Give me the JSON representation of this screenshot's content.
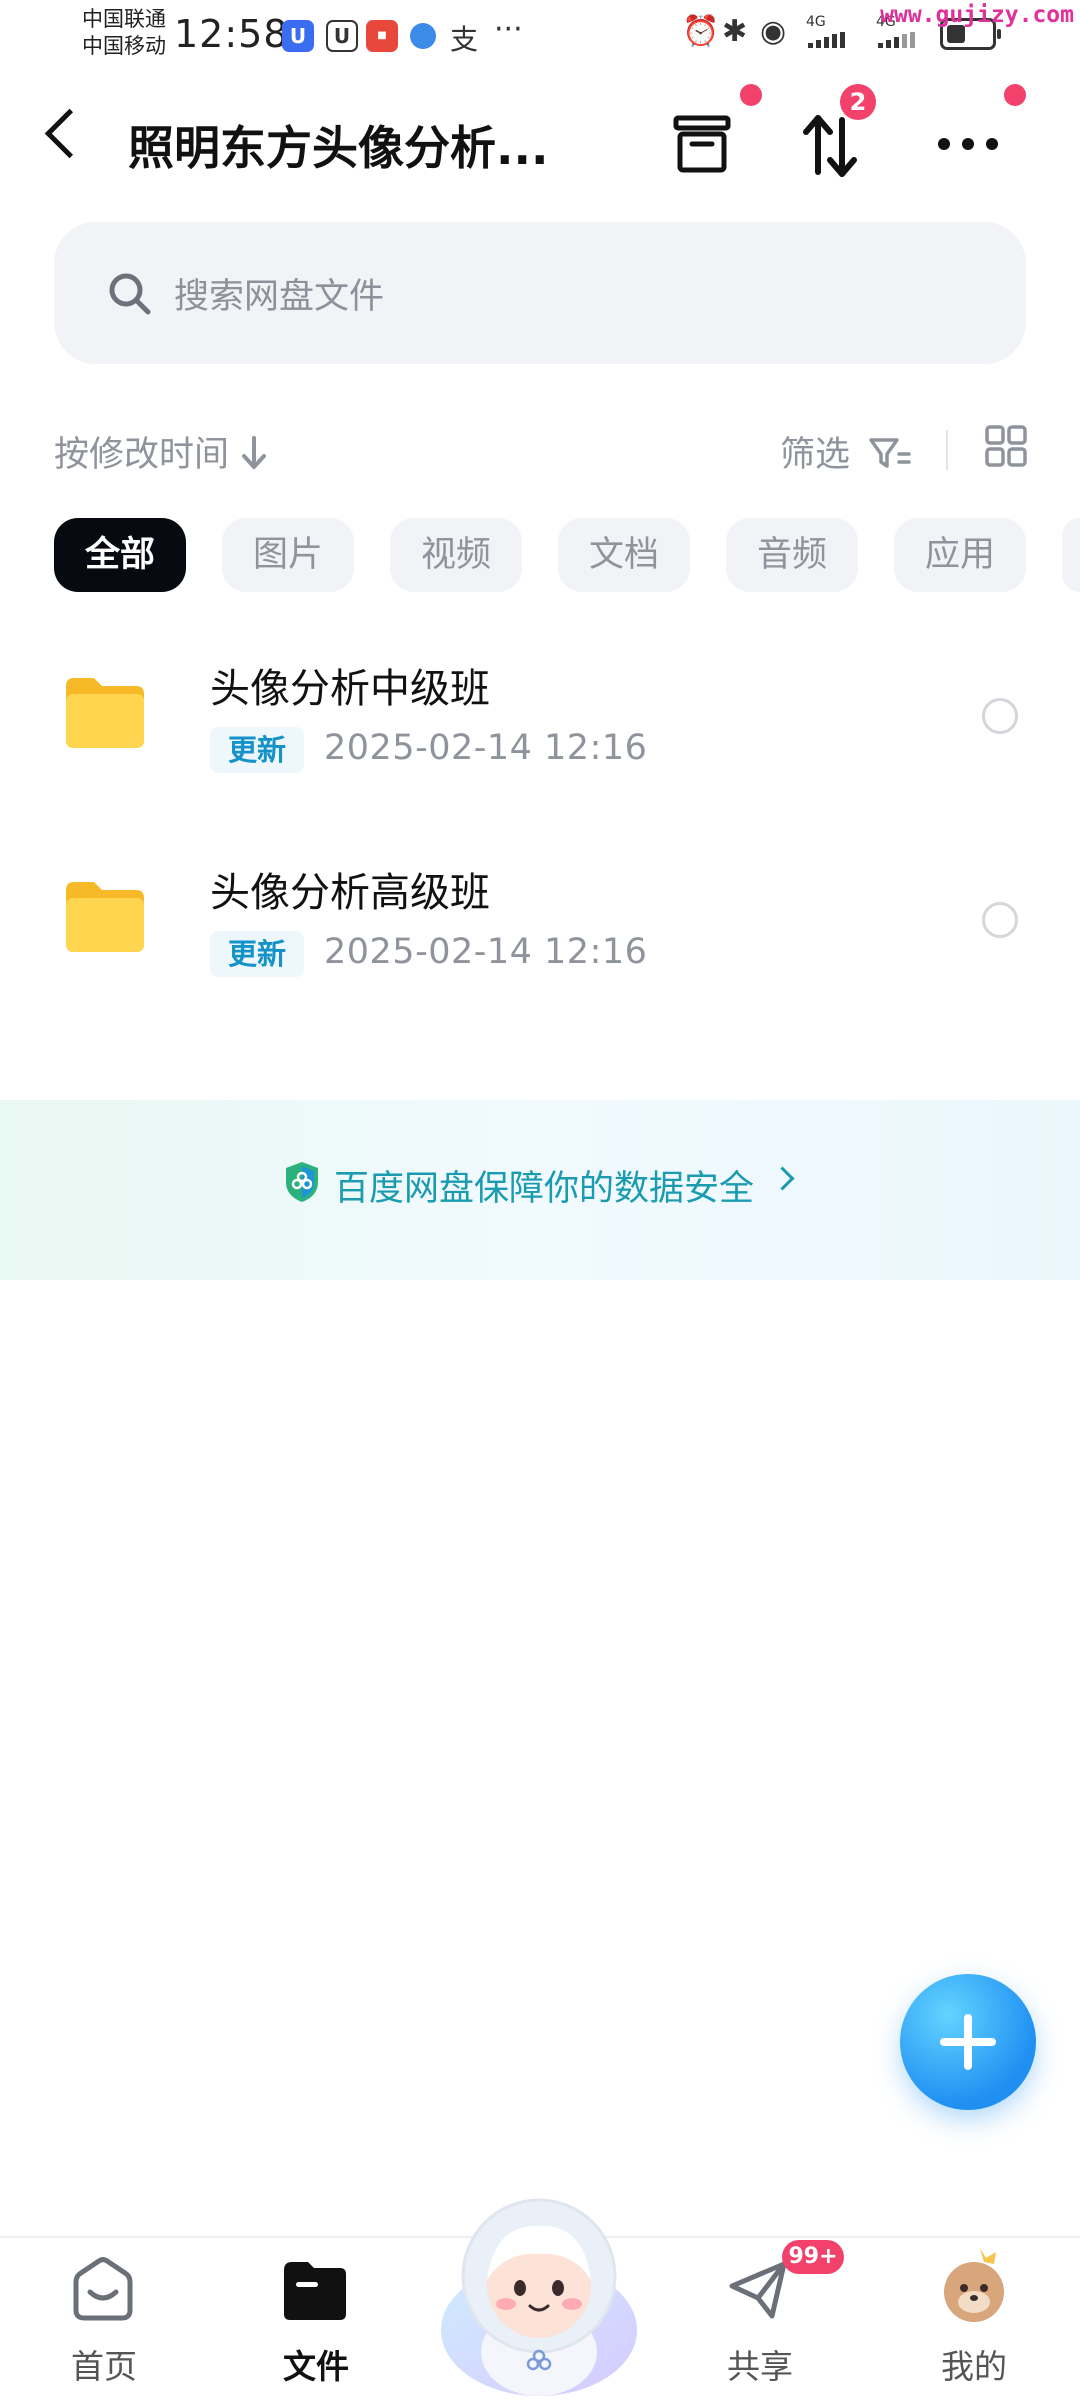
{
  "status_bar": {
    "carrier_1": "中国联通",
    "carrier_2": "中国移动",
    "time": "12:58",
    "network_1": "4G",
    "network_2": "4G",
    "watermark": "www.gujizy.com"
  },
  "header": {
    "title": "照明东方头像分析...",
    "transfer_badge": "2"
  },
  "search": {
    "placeholder": "搜索网盘文件"
  },
  "toolbar": {
    "sort_label": "按修改时间",
    "filter_label": "筛选"
  },
  "categories": [
    {
      "label": "全部",
      "active": true
    },
    {
      "label": "图片",
      "active": false
    },
    {
      "label": "视频",
      "active": false
    },
    {
      "label": "文档",
      "active": false
    },
    {
      "label": "音频",
      "active": false
    },
    {
      "label": "应用",
      "active": false
    }
  ],
  "files": [
    {
      "name": "头像分析中级班",
      "tag": "更新",
      "modified": "2025-02-14  12:16",
      "type": "folder"
    },
    {
      "name": "头像分析高级班",
      "tag": "更新",
      "modified": "2025-02-14  12:16",
      "type": "folder"
    }
  ],
  "safety_banner": {
    "text": "百度网盘保障你的数据安全"
  },
  "bottom_nav": {
    "items": [
      {
        "label": "首页",
        "icon": "home-icon",
        "active": false
      },
      {
        "label": "文件",
        "icon": "folder-icon",
        "active": true
      },
      {
        "label": "",
        "icon": "mascot-icon",
        "active": false
      },
      {
        "label": "共享",
        "icon": "share-icon",
        "active": false
      },
      {
        "label": "我的",
        "icon": "profile-avatar-icon",
        "active": false
      }
    ],
    "share_badge": "99+"
  },
  "colors": {
    "accent": "#1f8ff2",
    "badge": "#f2416b",
    "tag_text": "#1593c8",
    "folder": "#ffd24a",
    "active_chip": "#080a12"
  }
}
